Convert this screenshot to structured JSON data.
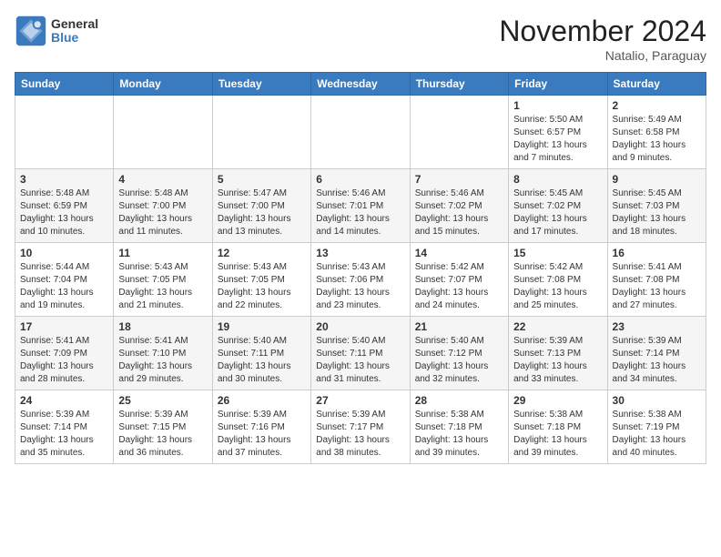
{
  "header": {
    "logo_general": "General",
    "logo_blue": "Blue",
    "month_title": "November 2024",
    "location": "Natalio, Paraguay"
  },
  "weekdays": [
    "Sunday",
    "Monday",
    "Tuesday",
    "Wednesday",
    "Thursday",
    "Friday",
    "Saturday"
  ],
  "weeks": [
    [
      {
        "day": "",
        "info": ""
      },
      {
        "day": "",
        "info": ""
      },
      {
        "day": "",
        "info": ""
      },
      {
        "day": "",
        "info": ""
      },
      {
        "day": "",
        "info": ""
      },
      {
        "day": "1",
        "info": "Sunrise: 5:50 AM\nSunset: 6:57 PM\nDaylight: 13 hours\nand 7 minutes."
      },
      {
        "day": "2",
        "info": "Sunrise: 5:49 AM\nSunset: 6:58 PM\nDaylight: 13 hours\nand 9 minutes."
      }
    ],
    [
      {
        "day": "3",
        "info": "Sunrise: 5:48 AM\nSunset: 6:59 PM\nDaylight: 13 hours\nand 10 minutes."
      },
      {
        "day": "4",
        "info": "Sunrise: 5:48 AM\nSunset: 7:00 PM\nDaylight: 13 hours\nand 11 minutes."
      },
      {
        "day": "5",
        "info": "Sunrise: 5:47 AM\nSunset: 7:00 PM\nDaylight: 13 hours\nand 13 minutes."
      },
      {
        "day": "6",
        "info": "Sunrise: 5:46 AM\nSunset: 7:01 PM\nDaylight: 13 hours\nand 14 minutes."
      },
      {
        "day": "7",
        "info": "Sunrise: 5:46 AM\nSunset: 7:02 PM\nDaylight: 13 hours\nand 15 minutes."
      },
      {
        "day": "8",
        "info": "Sunrise: 5:45 AM\nSunset: 7:02 PM\nDaylight: 13 hours\nand 17 minutes."
      },
      {
        "day": "9",
        "info": "Sunrise: 5:45 AM\nSunset: 7:03 PM\nDaylight: 13 hours\nand 18 minutes."
      }
    ],
    [
      {
        "day": "10",
        "info": "Sunrise: 5:44 AM\nSunset: 7:04 PM\nDaylight: 13 hours\nand 19 minutes."
      },
      {
        "day": "11",
        "info": "Sunrise: 5:43 AM\nSunset: 7:05 PM\nDaylight: 13 hours\nand 21 minutes."
      },
      {
        "day": "12",
        "info": "Sunrise: 5:43 AM\nSunset: 7:05 PM\nDaylight: 13 hours\nand 22 minutes."
      },
      {
        "day": "13",
        "info": "Sunrise: 5:43 AM\nSunset: 7:06 PM\nDaylight: 13 hours\nand 23 minutes."
      },
      {
        "day": "14",
        "info": "Sunrise: 5:42 AM\nSunset: 7:07 PM\nDaylight: 13 hours\nand 24 minutes."
      },
      {
        "day": "15",
        "info": "Sunrise: 5:42 AM\nSunset: 7:08 PM\nDaylight: 13 hours\nand 25 minutes."
      },
      {
        "day": "16",
        "info": "Sunrise: 5:41 AM\nSunset: 7:08 PM\nDaylight: 13 hours\nand 27 minutes."
      }
    ],
    [
      {
        "day": "17",
        "info": "Sunrise: 5:41 AM\nSunset: 7:09 PM\nDaylight: 13 hours\nand 28 minutes."
      },
      {
        "day": "18",
        "info": "Sunrise: 5:41 AM\nSunset: 7:10 PM\nDaylight: 13 hours\nand 29 minutes."
      },
      {
        "day": "19",
        "info": "Sunrise: 5:40 AM\nSunset: 7:11 PM\nDaylight: 13 hours\nand 30 minutes."
      },
      {
        "day": "20",
        "info": "Sunrise: 5:40 AM\nSunset: 7:11 PM\nDaylight: 13 hours\nand 31 minutes."
      },
      {
        "day": "21",
        "info": "Sunrise: 5:40 AM\nSunset: 7:12 PM\nDaylight: 13 hours\nand 32 minutes."
      },
      {
        "day": "22",
        "info": "Sunrise: 5:39 AM\nSunset: 7:13 PM\nDaylight: 13 hours\nand 33 minutes."
      },
      {
        "day": "23",
        "info": "Sunrise: 5:39 AM\nSunset: 7:14 PM\nDaylight: 13 hours\nand 34 minutes."
      }
    ],
    [
      {
        "day": "24",
        "info": "Sunrise: 5:39 AM\nSunset: 7:14 PM\nDaylight: 13 hours\nand 35 minutes."
      },
      {
        "day": "25",
        "info": "Sunrise: 5:39 AM\nSunset: 7:15 PM\nDaylight: 13 hours\nand 36 minutes."
      },
      {
        "day": "26",
        "info": "Sunrise: 5:39 AM\nSunset: 7:16 PM\nDaylight: 13 hours\nand 37 minutes."
      },
      {
        "day": "27",
        "info": "Sunrise: 5:39 AM\nSunset: 7:17 PM\nDaylight: 13 hours\nand 38 minutes."
      },
      {
        "day": "28",
        "info": "Sunrise: 5:38 AM\nSunset: 7:18 PM\nDaylight: 13 hours\nand 39 minutes."
      },
      {
        "day": "29",
        "info": "Sunrise: 5:38 AM\nSunset: 7:18 PM\nDaylight: 13 hours\nand 39 minutes."
      },
      {
        "day": "30",
        "info": "Sunrise: 5:38 AM\nSunset: 7:19 PM\nDaylight: 13 hours\nand 40 minutes."
      }
    ]
  ]
}
